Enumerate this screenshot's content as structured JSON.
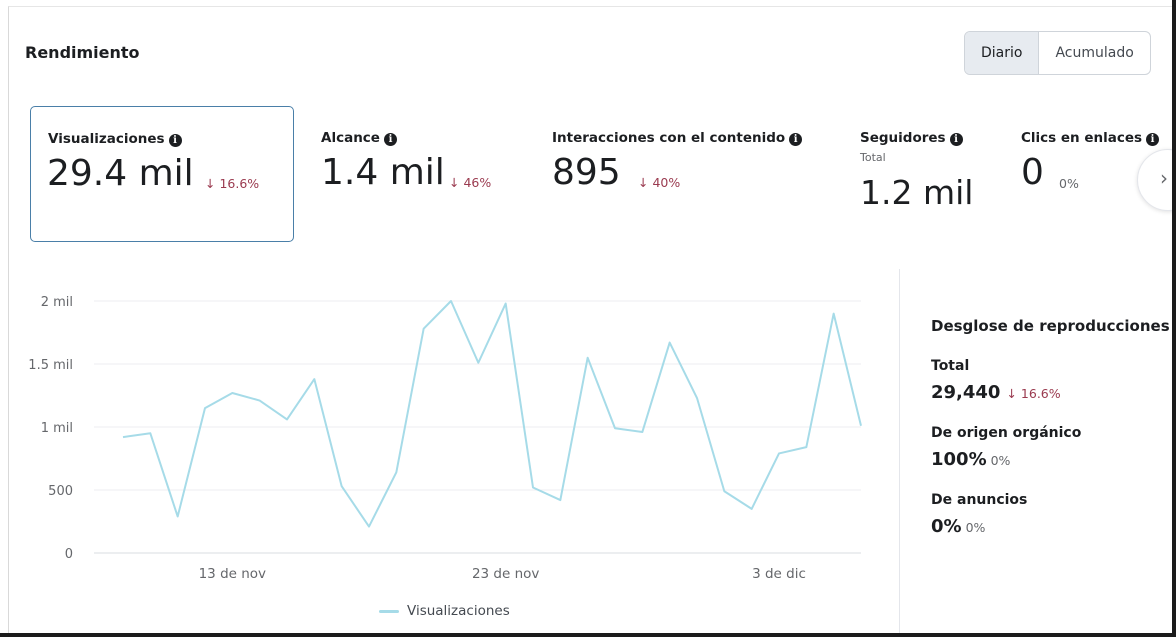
{
  "header": {
    "title": "Rendimiento"
  },
  "toggle": {
    "options": [
      "Diario",
      "Acumulado"
    ],
    "selected": "Diario"
  },
  "metrics": [
    {
      "label": "Visualizaciones",
      "value": "29.4 mil",
      "delta": "↓ 16.6%",
      "selected": true
    },
    {
      "label": "Alcance",
      "value": "1.4 mil",
      "delta": "↓ 46%"
    },
    {
      "label": "Interacciones con el contenido",
      "value": "895",
      "delta": "↓ 40%"
    },
    {
      "label": "Seguidores",
      "sublabel": "Total",
      "value": "1.2 mil"
    },
    {
      "label": "Clics en enlaces",
      "value": "0",
      "delta": "0%"
    }
  ],
  "chart_data": {
    "type": "line",
    "y_tick_labels": [
      "0",
      "500",
      "1 mil",
      "1.5 mil",
      "2 mil"
    ],
    "y_ticks": [
      0,
      500,
      1000,
      1500,
      2000
    ],
    "ylim": [
      0,
      2000
    ],
    "x_tick_labels": [
      "13 de nov",
      "23 de nov",
      "3 de dic"
    ],
    "x_tick_indices": [
      4,
      14,
      24
    ],
    "series": [
      {
        "name": "Visualizaciones",
        "color": "#a6dbe8",
        "values": [
          920,
          950,
          290,
          1150,
          1270,
          1210,
          1060,
          1380,
          530,
          210,
          640,
          1780,
          2000,
          1510,
          1980,
          520,
          420,
          1550,
          990,
          960,
          1670,
          1230,
          490,
          350,
          790,
          840,
          1900,
          1010
        ]
      }
    ],
    "grid": true
  },
  "legend": {
    "label": "Visualizaciones"
  },
  "breakdown": {
    "title": "Desglose de reproducciones",
    "total_label": "Total",
    "total_value": "29,440",
    "total_delta": "↓ 16.6%",
    "organic_label": "De origen orgánico",
    "organic_value": "100%",
    "organic_delta": "0%",
    "ads_label": "De anuncios",
    "ads_value": "0%",
    "ads_delta": "0%"
  },
  "icons": {
    "info": "info-icon",
    "next": "chevron-right-icon"
  }
}
